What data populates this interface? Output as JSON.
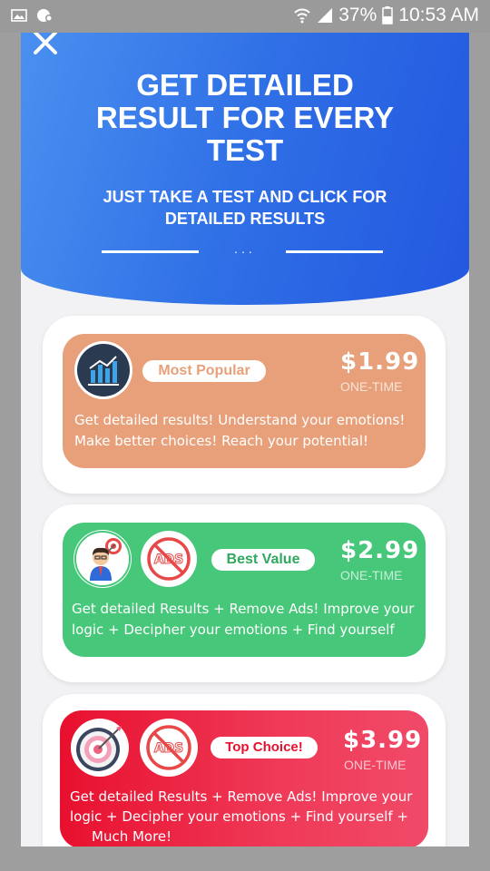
{
  "status_bar": {
    "battery": "37%",
    "time": "10:53 AM",
    "icons": [
      "image-icon",
      "notification-icon",
      "wifi-icon",
      "signal-icon",
      "battery-icon"
    ]
  },
  "header": {
    "title_lines": [
      "GET DETAILED",
      "RESULT FOR EVERY",
      "TEST"
    ],
    "subtitle_lines": [
      "JUST TAKE A TEST AND CLICK FOR",
      "DETAILED RESULTS"
    ],
    "dots": "...",
    "close_icon": "close-icon"
  },
  "plans": [
    {
      "badge": "Most Popular",
      "price": "$1.99",
      "period": "ONE-TIME",
      "desc_lines": [
        "Get detailed results! Understand your emotions!",
        "Make better choices! Reach your potential!"
      ],
      "icons": [
        "bar-chart-icon"
      ],
      "color": "#e8a07a"
    },
    {
      "badge": "Best Value",
      "price": "$2.99",
      "period": "ONE-TIME",
      "desc_lines": [
        "Get detailed Results + Remove Ads! Improve your",
        "logic + Decipher your emotions + Find yourself"
      ],
      "icons": [
        "businessman-target-icon",
        "no-ads-icon"
      ],
      "color": "#47c77a"
    },
    {
      "badge": "Top Choice!",
      "price": "$3.99",
      "period": "ONE-TIME",
      "desc_lines": [
        "Get detailed Results + Remove Ads! Improve your",
        "logic + Decipher your emotions + Find yourself +",
        "Much More!"
      ],
      "icons": [
        "target-icon",
        "no-ads-icon"
      ],
      "color": "#e8102e"
    }
  ]
}
